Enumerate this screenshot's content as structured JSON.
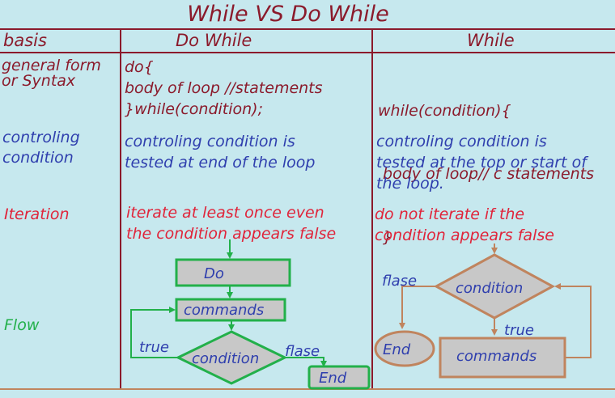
{
  "title": "While VS Do While",
  "headers": {
    "basis": "basis",
    "do_while": "Do While",
    "while": "While"
  },
  "rows": {
    "syntax": {
      "label": [
        "general form",
        " or Syntax"
      ],
      "do_while": [
        "do{",
        "body of loop //statements",
        "}while(condition);"
      ],
      "while": [
        "while(condition){",
        " body of loop// c statements",
        " }"
      ]
    },
    "condition": {
      "label": [
        "controling",
        "condition"
      ],
      "do_while": [
        "controling condition is",
        "tested at end of the  loop"
      ],
      "while": [
        "controling condition is",
        "tested at the top or start of",
        "the loop."
      ]
    },
    "iteration": {
      "label": "Iteration",
      "do_while": [
        "iterate at least once even",
        "the condition appears false"
      ],
      "while": [
        "do not iterate if the",
        "condition appears false"
      ]
    },
    "flow": {
      "label": "Flow",
      "do_while_chart": {
        "start": "Do",
        "body": "commands",
        "decision": "condition",
        "true_label": "true",
        "false_label": "flase",
        "end": "End"
      },
      "while_chart": {
        "decision": "condition",
        "false_label": "flase",
        "true_label": "true",
        "end": "End",
        "body": "commands"
      }
    }
  },
  "colors": {
    "background": "#c6e8ee",
    "grid": "#8b1a2b",
    "heading": "#8b1a2b",
    "blue_text": "#2f3fae",
    "red_text": "#e0243a",
    "green_text": "#22b04a",
    "flow_green": "#22b04a",
    "flow_brown": "#c0845e",
    "box_fill": "#c8c8c8"
  }
}
